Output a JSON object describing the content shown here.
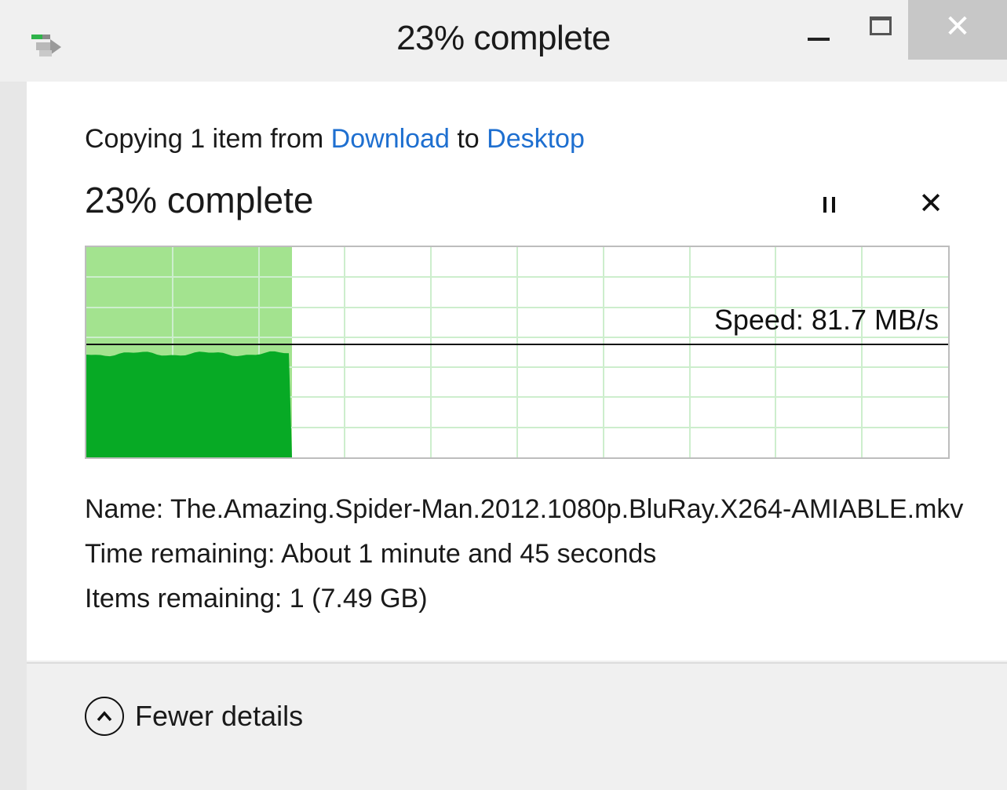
{
  "window": {
    "title": "23% complete",
    "icon": "copy-transfer-icon",
    "controls": {
      "minimize": "minimize",
      "maximize": "maximize",
      "close": "✕"
    }
  },
  "operation": {
    "prefix": "Copying 1 item from ",
    "source": "Download",
    "middle": " to ",
    "destination": "Desktop"
  },
  "progress": {
    "label": "23% complete",
    "fraction": 0.23,
    "pause_icon": "pause-icon",
    "cancel_label": "✕"
  },
  "graph": {
    "speed_text": "Speed: 81.7 MB/s",
    "colors": {
      "fill_dark": "#07aa25",
      "fill_light": "#a3e38f",
      "grid": "#cdeecd"
    }
  },
  "details": {
    "name_label": "Name:",
    "name_value": "The.Amazing.Spider-Man.2012.1080p.BluRay.X264-AMIABLE.mkv",
    "time_label": "Time remaining:",
    "time_value": "About 1 minute and 45 seconds",
    "items_label": "Items remaining:",
    "items_value": "1 (7.49 GB)"
  },
  "footer": {
    "toggle_label": "Fewer details",
    "toggle_icon": "chevron-up-icon"
  }
}
